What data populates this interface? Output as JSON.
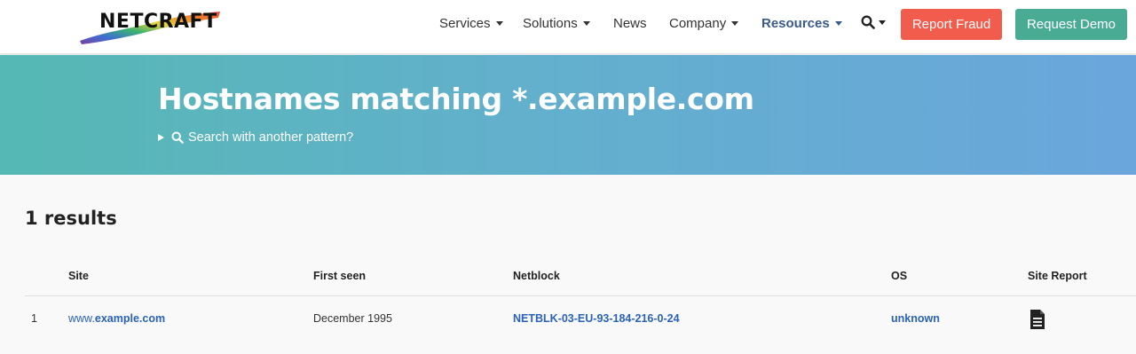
{
  "header": {
    "logo_text": "NETCRAFT",
    "nav": [
      {
        "label": "Services",
        "has_caret": true
      },
      {
        "label": "Solutions",
        "has_caret": true
      },
      {
        "label": "News",
        "has_caret": false
      },
      {
        "label": "Company",
        "has_caret": true
      },
      {
        "label": "Resources",
        "has_caret": true
      }
    ],
    "search_icon": "search-icon",
    "report_fraud_label": "Report Fraud",
    "request_demo_label": "Request Demo",
    "colors": {
      "report_fraud": "#f25c4c",
      "request_demo": "#4aab94",
      "active_nav": "#3a5a8a"
    }
  },
  "banner": {
    "title": "Hostnames matching *.example.com",
    "pattern_toggle_label": "Search with another pattern?"
  },
  "results": {
    "heading": "1 results",
    "columns": [
      "Site",
      "First seen",
      "Netblock",
      "OS",
      "Site Report"
    ],
    "rows": [
      {
        "index": "1",
        "site_prefix": "www.",
        "site_domain": "example.com",
        "first_seen": "December 1995",
        "netblock": "NETBLK-03-EU-93-184-216-0-24",
        "os": "unknown",
        "report_icon": "document-icon"
      }
    ]
  }
}
